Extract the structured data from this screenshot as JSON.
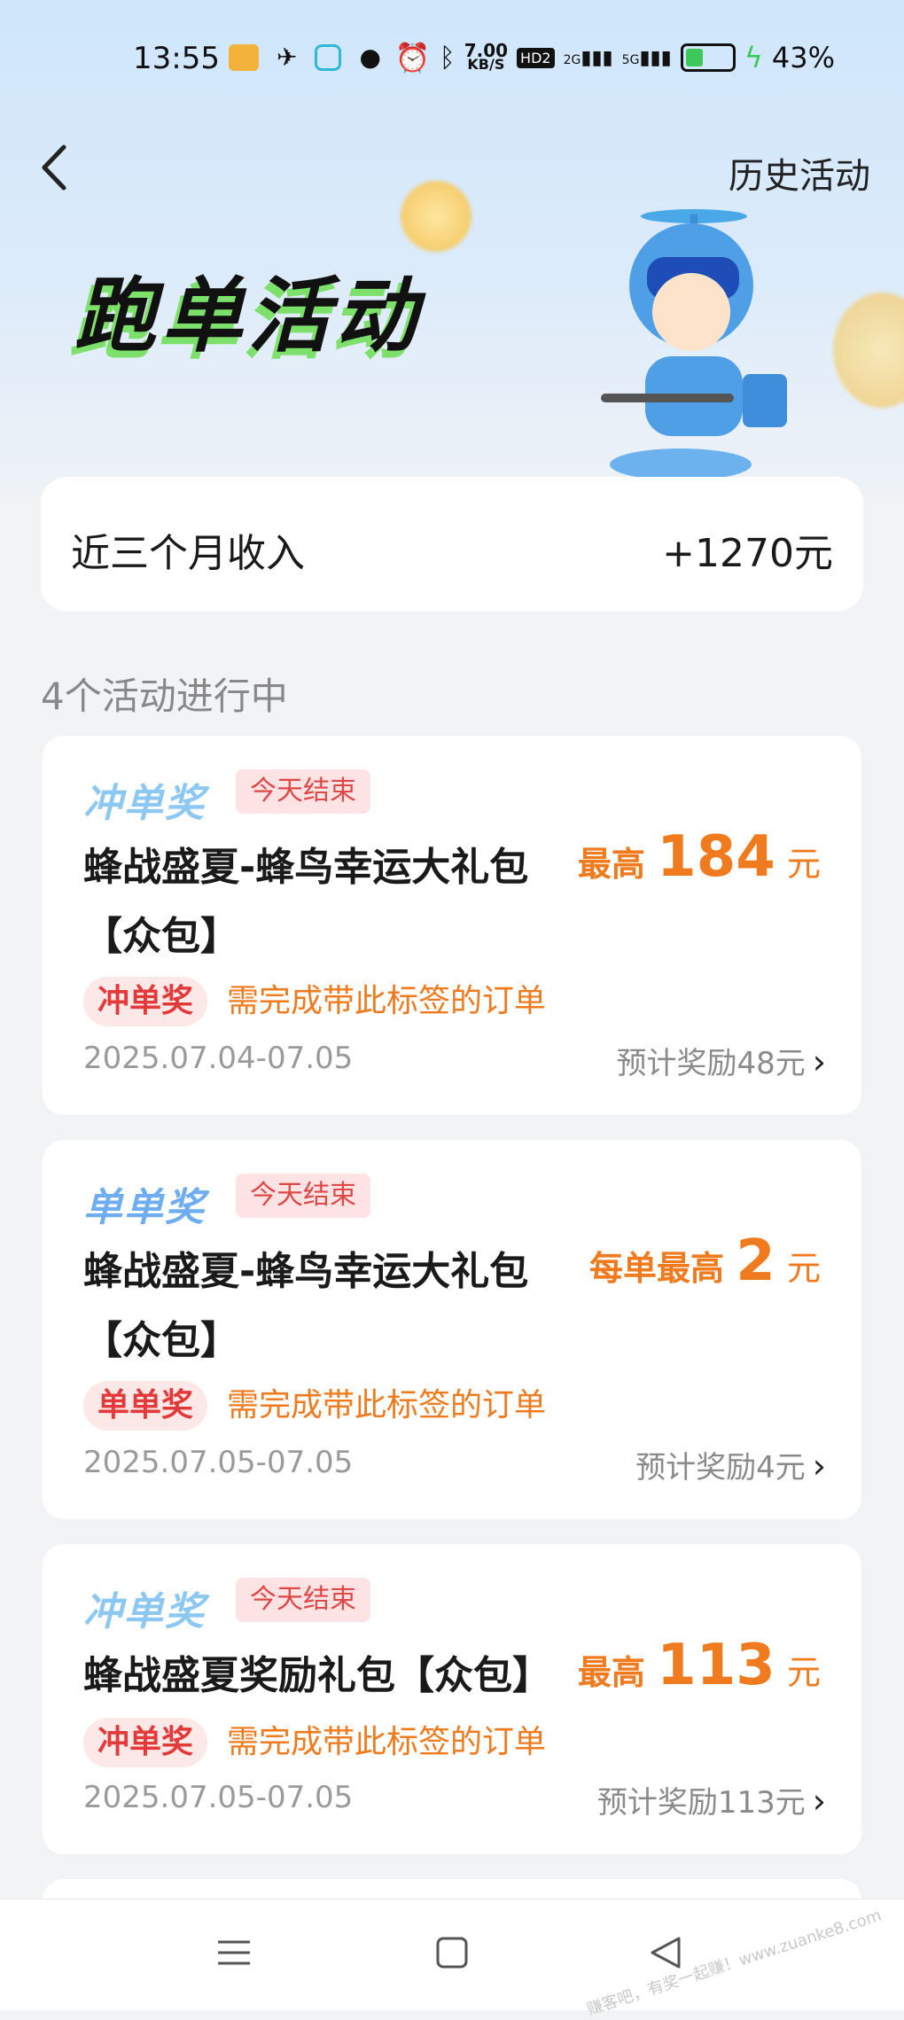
{
  "status_bar": {
    "time": "13:55",
    "net_speed_value": "7.00",
    "net_speed_unit": "KB/S",
    "hd_label": "HD2",
    "sig1_label": "2G",
    "sig2_label": "5G",
    "battery_percent_text": "43%",
    "battery_level": 0.43
  },
  "header": {
    "back_icon": "chevron-left-icon",
    "history_label": "历史活动",
    "hero_title": "跑单活动"
  },
  "income": {
    "label": "近三个月收入",
    "value": "+1270元"
  },
  "section": {
    "title": "4个活动进行中"
  },
  "activities": [
    {
      "kind_logo": "冲单奖",
      "end_badge": "今天结束",
      "title": "蜂战盛夏-蜂鸟幸运大礼包【众包】",
      "reward_prefix": "最高",
      "reward_amount": "184",
      "reward_unit": "元",
      "tag": "冲单奖",
      "tag_note": "需完成带此标签的订单",
      "date_range": "2025.07.04-07.05",
      "estimate": "预计奖励48元"
    },
    {
      "kind_logo": "单单奖",
      "end_badge": "今天结束",
      "title": "蜂战盛夏-蜂鸟幸运大礼包【众包】",
      "reward_prefix": "每单最高",
      "reward_amount": "2",
      "reward_unit": "元",
      "tag": "单单奖",
      "tag_note": "需完成带此标签的订单",
      "date_range": "2025.07.05-07.05",
      "estimate": "预计奖励4元"
    },
    {
      "kind_logo": "冲单奖",
      "end_badge": "今天结束",
      "title": "蜂战盛夏奖励礼包【众包】",
      "reward_prefix": "最高",
      "reward_amount": "113",
      "reward_unit": "元",
      "tag": "冲单奖",
      "tag_note": "需完成带此标签的订单",
      "date_range": "2025.07.05-07.05",
      "estimate": "预计奖励113元"
    }
  ],
  "nav": {
    "menu_icon": "menu-icon",
    "home_icon": "home-square-icon",
    "back_icon": "back-triangle-icon"
  },
  "watermark": "赚客吧，有奖一起赚！www.zuanke8.com",
  "colors": {
    "accent_orange": "#f07a1e",
    "tag_red": "#e23a3a",
    "logo_blue": "#8cc8f2"
  }
}
